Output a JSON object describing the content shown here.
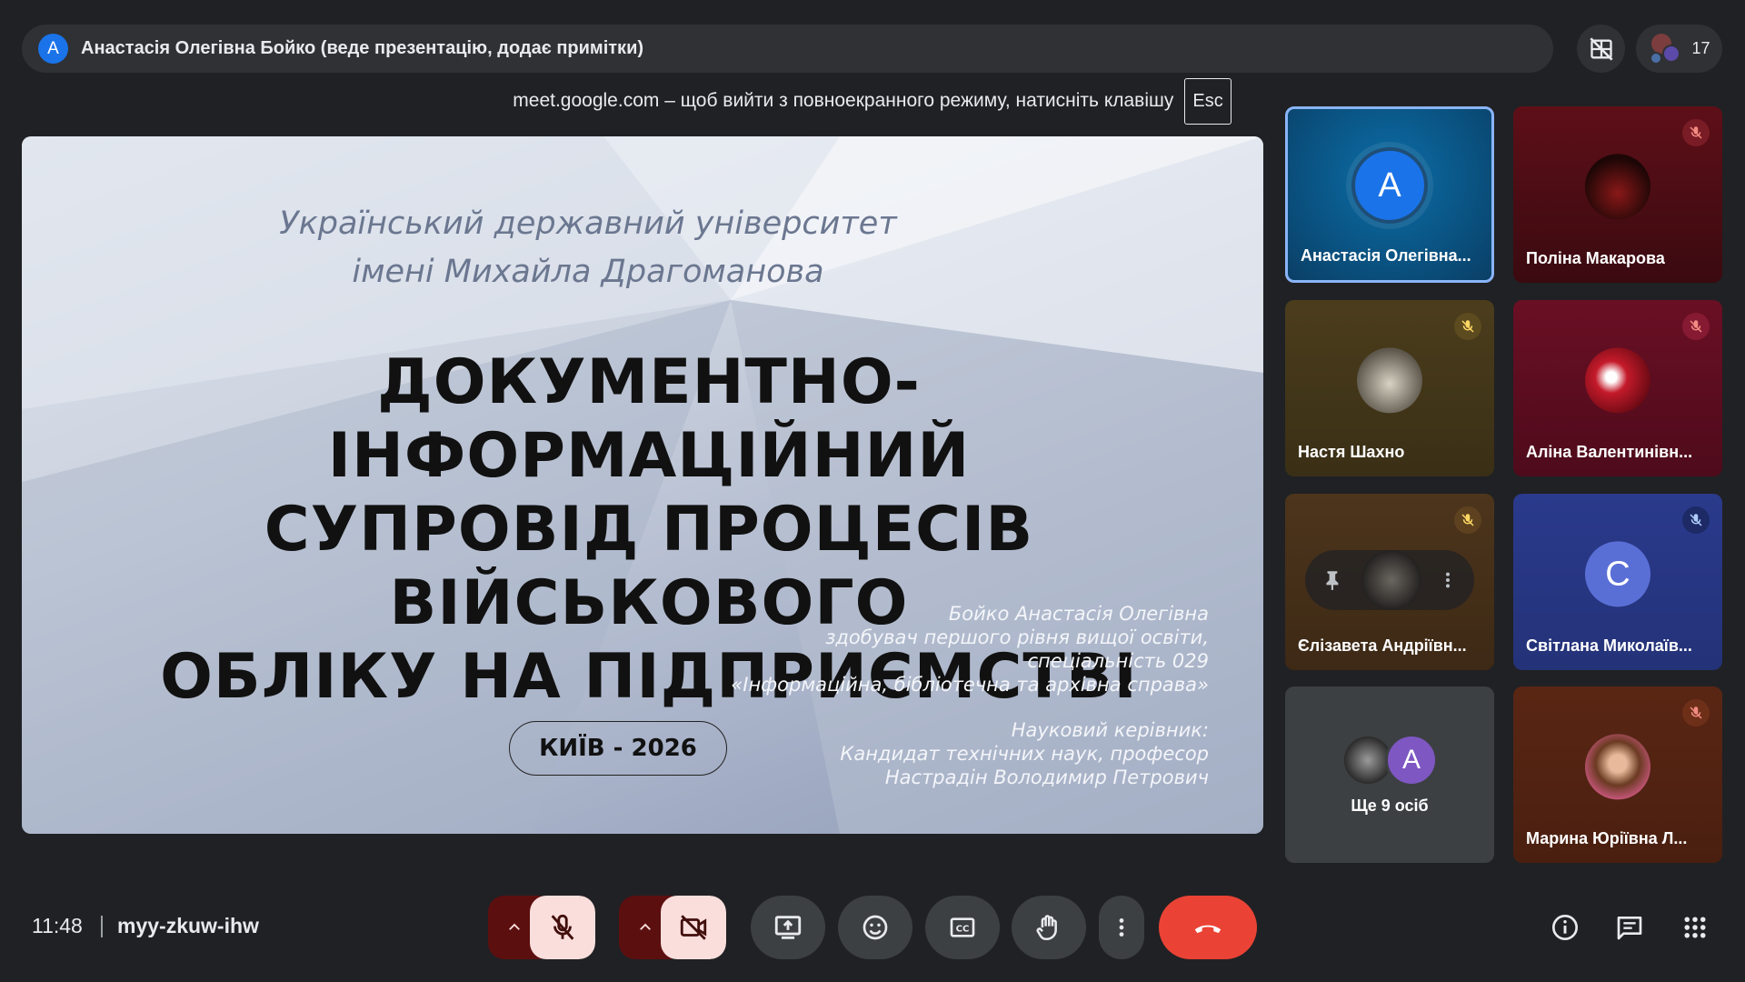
{
  "presenter_bar": {
    "avatar_letter": "А",
    "text": "Анастасія Олегівна Бойко (веде презентацію, додає примітки)"
  },
  "top_right": {
    "hide_tiles_icon": "hide-tiles-icon",
    "people_count": "17"
  },
  "fullscreen_notice": {
    "text": "meet.google.com – щоб вийти з повноекранного режиму, натисніть клавішу",
    "key": "Esc"
  },
  "slide": {
    "university_line1": "Український державний університет",
    "university_line2": "імені Михайла Драгоманова",
    "title_line1": "ДОКУМЕНТНО-ІНФОРМАЦІЙНИЙ",
    "title_line2": "СУПРОВІД ПРОЦЕСІВ ВІЙСЬКОВОГО",
    "title_line3": "ОБЛІКУ НА ПІДПРИЄМСТВІ",
    "author": "Бойко Анастасія Олегівна",
    "degree": "здобувач першого рівня вищої освіти,",
    "specialty": "спеціальність 029",
    "specialty_name": "«Інформаційна, бібліотечна та архівна справа»",
    "supervisor_label": "Науковий керівник:",
    "supervisor_title": "Кандидат технічних наук, професор",
    "supervisor_name": "Настрадін Володимир Петрович",
    "city_year": "КИЇВ - 2026"
  },
  "tiles": [
    {
      "name": "Анастасія Олегівна...",
      "avatar_letter": "А",
      "muted": false,
      "active": true
    },
    {
      "name": "Поліна Макарова",
      "muted": true
    },
    {
      "name": "Настя Шахно",
      "muted": true
    },
    {
      "name": "Аліна Валентинівн...",
      "muted": true
    },
    {
      "name": "Єлізавета Андріївн...",
      "muted": true
    },
    {
      "name": "Світлана Миколаїв...",
      "avatar_letter": "С",
      "muted": true
    },
    {
      "name": "Ще 9 осіб",
      "avatar_letter": "А"
    },
    {
      "name": "Марина Юріївна Л...",
      "muted": true
    }
  ],
  "bottom_bar": {
    "time": "11:48",
    "meeting_code": "myy-zkuw-ihw"
  },
  "colors": {
    "background": "#202124",
    "leave_red": "#ea4335",
    "muted_pink": "#f9dedc",
    "accent_blue": "#8ab4f8"
  }
}
